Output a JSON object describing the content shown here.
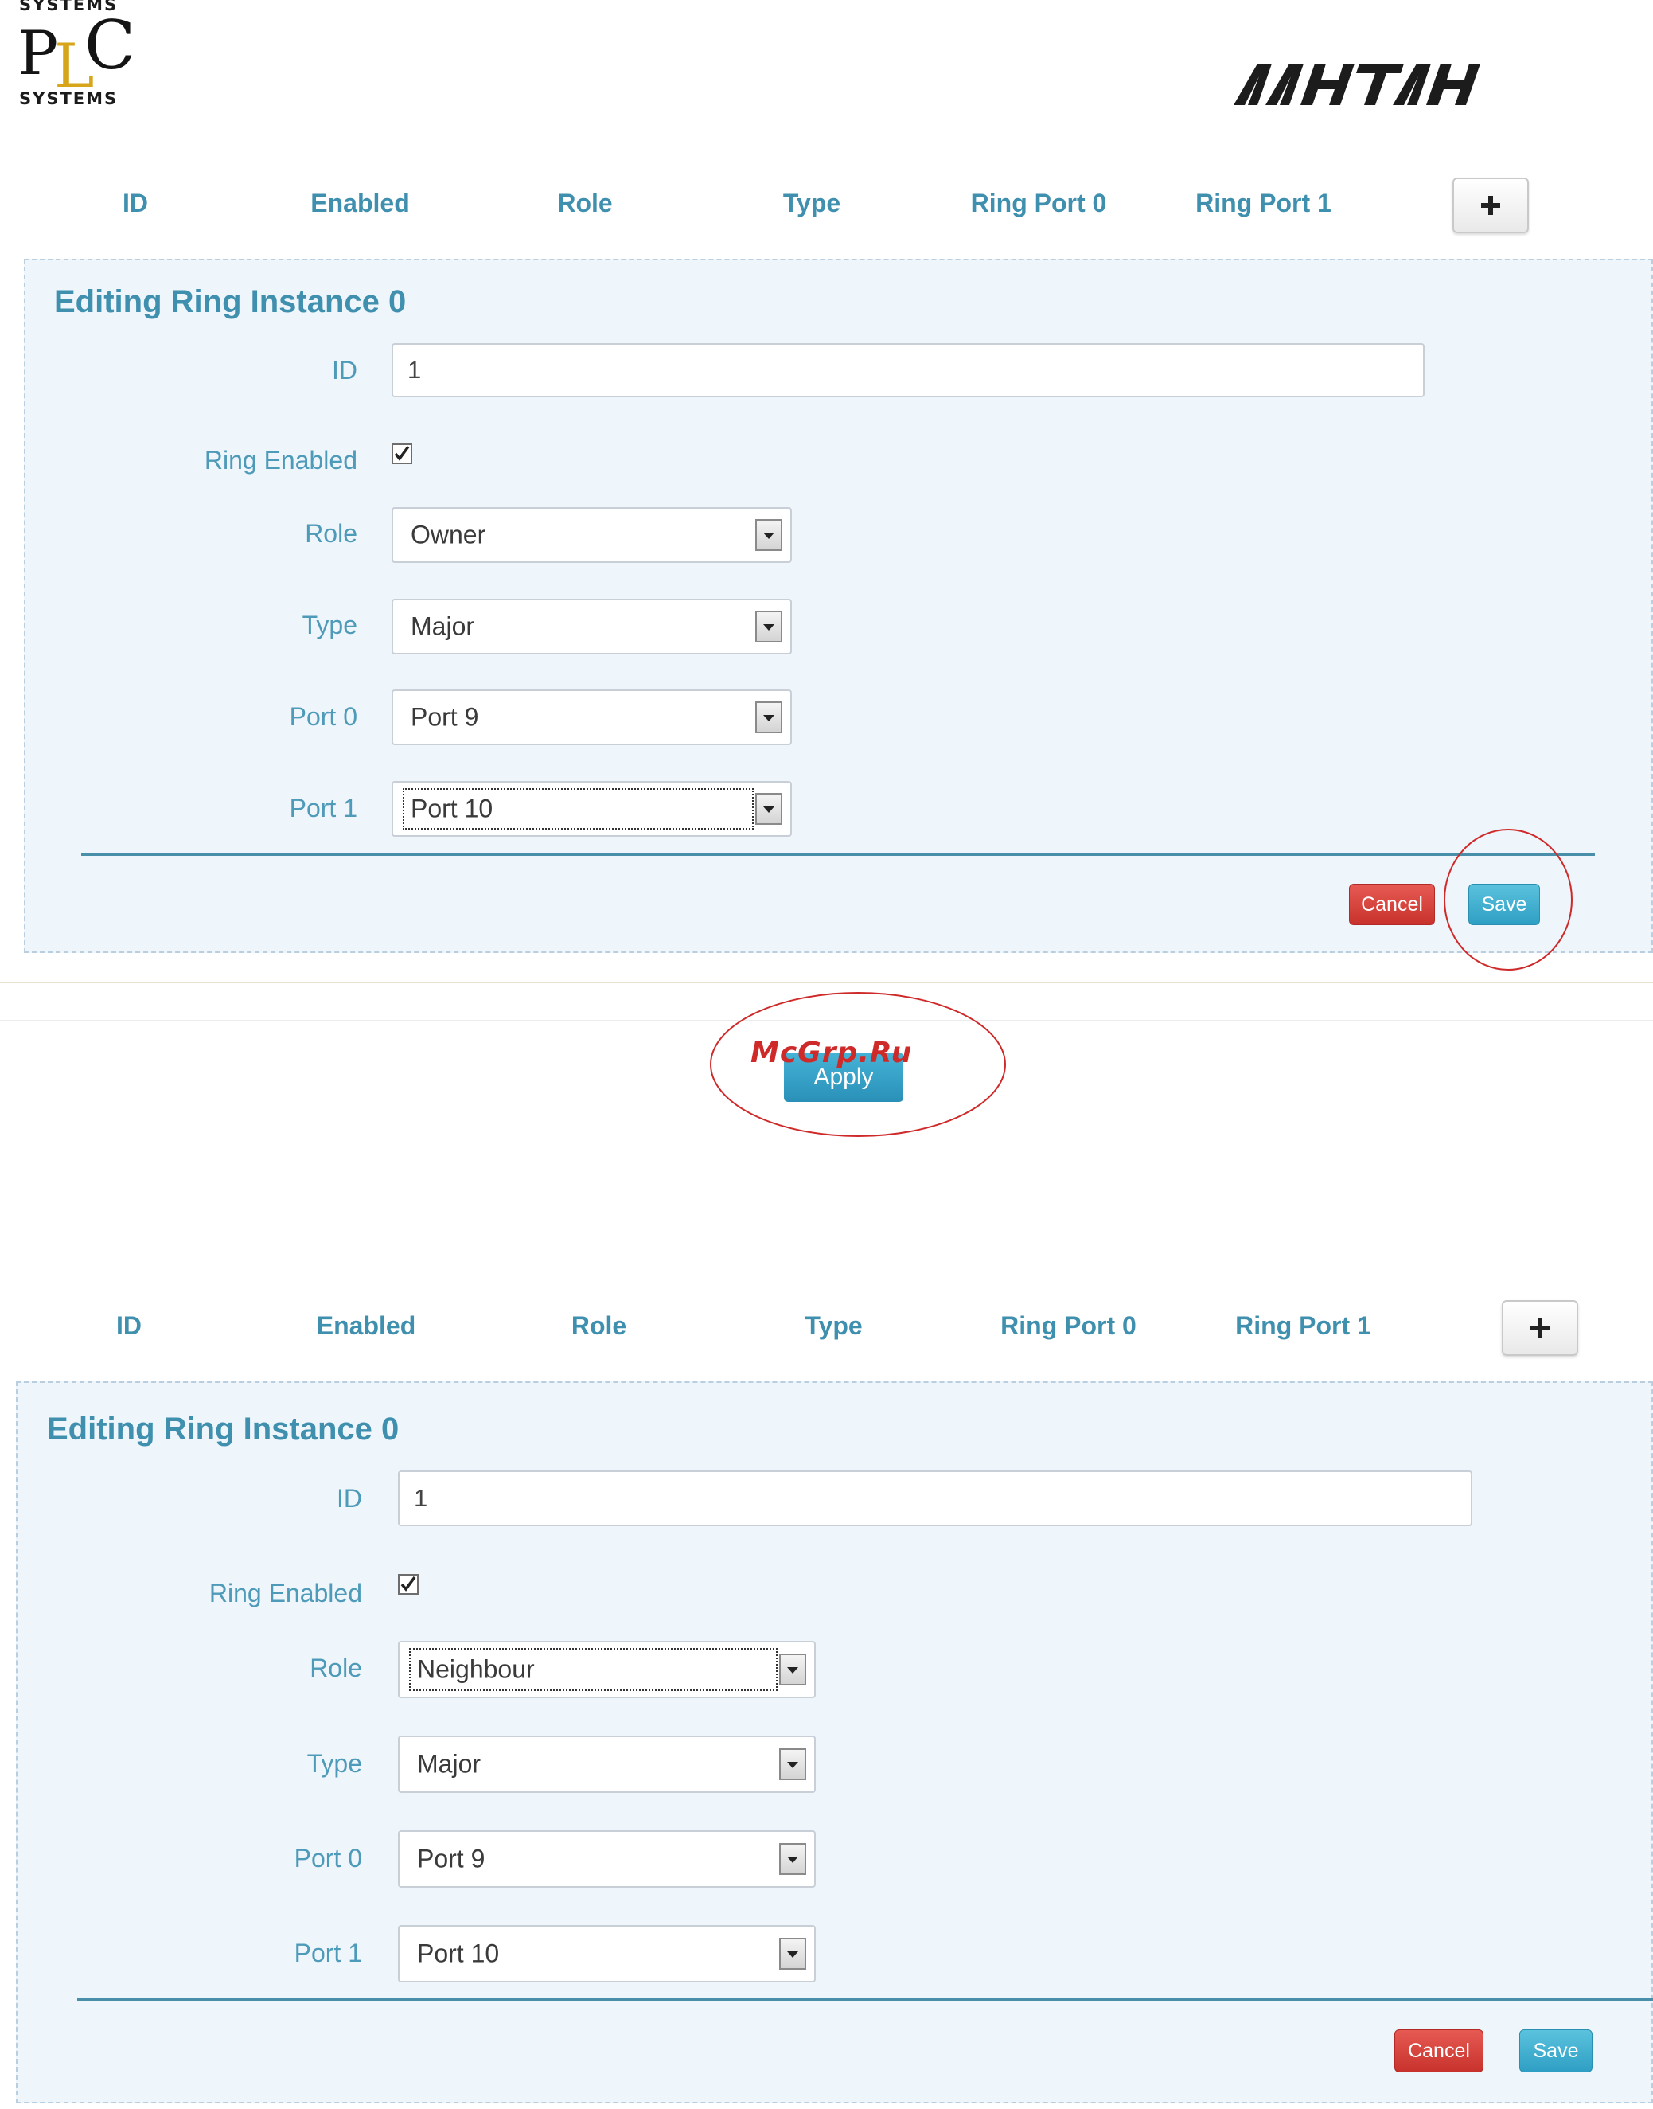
{
  "header": {
    "plc_logo": {
      "top_text": "SYSTEMS",
      "letters": [
        "P",
        "L",
        "C"
      ],
      "bottom_text": "SYSTEMS"
    },
    "brand_logo": "ΛΑΗΤΑΗ"
  },
  "table_header": {
    "columns": [
      "ID",
      "Enabled",
      "Role",
      "Type",
      "Ring Port 0",
      "Ring Port 1"
    ],
    "add_button_icon": "plus-icon"
  },
  "editor_top": {
    "title": "Editing Ring Instance 0",
    "id_label": "ID",
    "id_value": "1",
    "ring_enabled_label": "Ring Enabled",
    "ring_enabled_checked": true,
    "role_label": "Role",
    "role_value": "Owner",
    "type_label": "Type",
    "type_value": "Major",
    "port0_label": "Port 0",
    "port0_value": "Port 9",
    "port1_label": "Port 1",
    "port1_value": "Port 10",
    "cancel_label": "Cancel",
    "save_label": "Save"
  },
  "apply": {
    "label": "Apply",
    "watermark": "McGrp.Ru"
  },
  "editor_bottom": {
    "title": "Editing Ring Instance 0",
    "id_label": "ID",
    "id_value": "1",
    "ring_enabled_label": "Ring Enabled",
    "ring_enabled_checked": true,
    "role_label": "Role",
    "role_value": "Neighbour",
    "type_label": "Type",
    "type_value": "Major",
    "port0_label": "Port 0",
    "port0_value": "Port 9",
    "port1_label": "Port 1",
    "port1_value": "Port 10",
    "cancel_label": "Cancel",
    "save_label": "Save"
  },
  "colors": {
    "accent": "#3f8fae",
    "panel_bg": "#eef5fb",
    "cancel": "#d9423c",
    "save": "#3aaed3",
    "annotation": "#cf2a2a"
  }
}
